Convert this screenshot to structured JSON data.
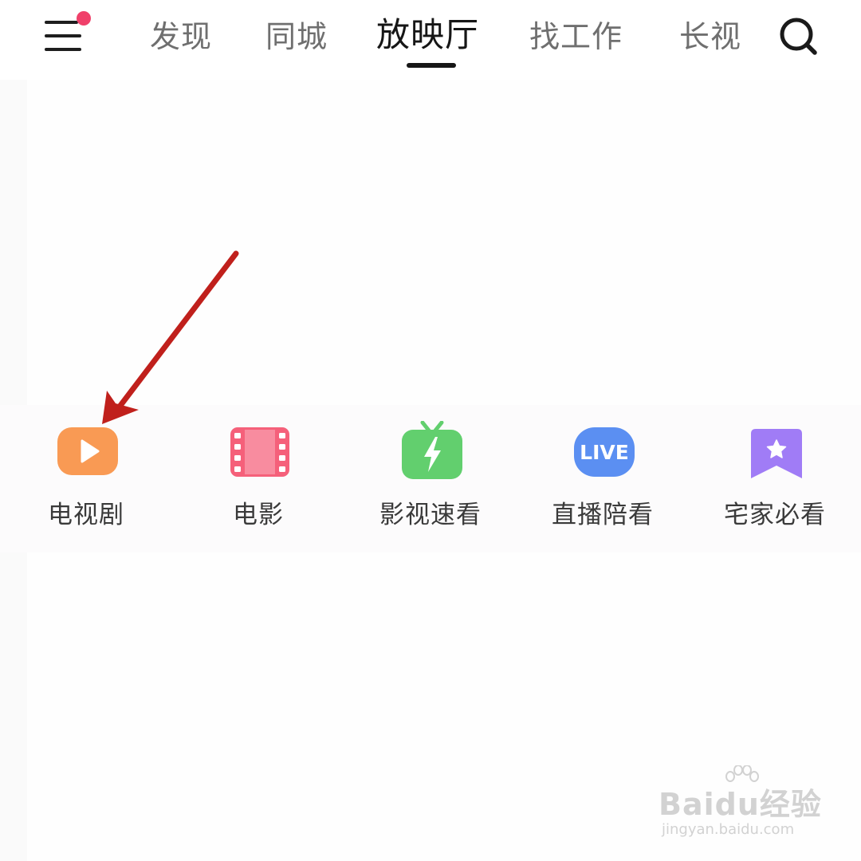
{
  "header": {
    "menu_icon": "hamburger-menu-icon",
    "notification_dot_color": "#f0406a",
    "tabs": [
      {
        "label": "发现",
        "active": false
      },
      {
        "label": "同城",
        "active": false
      },
      {
        "label": "放映厅",
        "active": true
      },
      {
        "label": "找工作",
        "active": false
      },
      {
        "label": "长视",
        "active": false
      }
    ],
    "search_icon": "search-icon"
  },
  "categories": [
    {
      "label": "电视剧",
      "icon": "play-icon",
      "color": "#f99a54"
    },
    {
      "label": "电影",
      "icon": "film-strip-icon",
      "color": "#f5607a"
    },
    {
      "label": "影视速看",
      "icon": "tv-lightning-icon",
      "color": "#62cf6e"
    },
    {
      "label": "直播陪看",
      "icon": "live-badge-icon",
      "color": "#5b8ff2",
      "badge_text": "LIVE"
    },
    {
      "label": "宅家必看",
      "icon": "star-bookmark-icon",
      "color": "#a07cf6"
    }
  ],
  "annotation": {
    "arrow_color": "#c0201c"
  },
  "watermark": {
    "logo": "Baidu经验",
    "url": "jingyan.baidu.com"
  }
}
